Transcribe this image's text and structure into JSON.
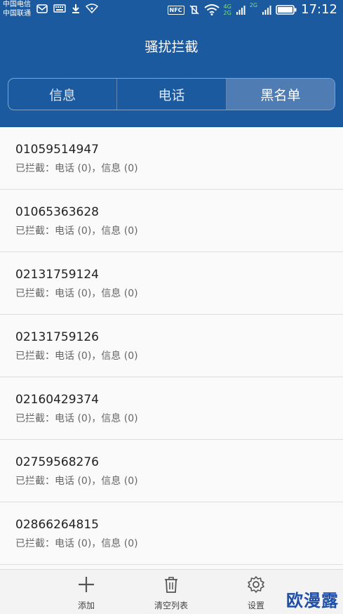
{
  "status_bar": {
    "carrier_1": "中国电信",
    "carrier_2": "中国联通",
    "net_label_1": "4G",
    "net_label_2": "2G",
    "net_label_3": "2G",
    "nfc_label": "NFC",
    "time": "17:12"
  },
  "title": "骚扰拦截",
  "tabs": [
    {
      "label": "信息",
      "active": false
    },
    {
      "label": "电话",
      "active": false
    },
    {
      "label": "黑名单",
      "active": true
    }
  ],
  "blacklist": [
    {
      "number": "01059514947",
      "summary": "已拦截：电话 (0)，信息 (0)"
    },
    {
      "number": "01065363628",
      "summary": "已拦截：电话 (0)，信息 (0)"
    },
    {
      "number": "02131759124",
      "summary": "已拦截：电话 (0)，信息 (0)"
    },
    {
      "number": "02131759126",
      "summary": "已拦截：电话 (0)，信息 (0)"
    },
    {
      "number": "02160429374",
      "summary": "已拦截：电话 (0)，信息 (0)"
    },
    {
      "number": "02759568276",
      "summary": "已拦截：电话 (0)，信息 (0)"
    },
    {
      "number": "02866264815",
      "summary": "已拦截：电话 (0)，信息 (0)"
    }
  ],
  "bottom_bar": {
    "add_label": "添加",
    "clear_label": "清空列表",
    "settings_label": "设置"
  },
  "watermark": "欧漫露",
  "colors": {
    "header": "#1c5aa0",
    "tab_active": "#4f7db3",
    "list_bg": "#fafafa",
    "watermark": "#1f4fa6"
  }
}
